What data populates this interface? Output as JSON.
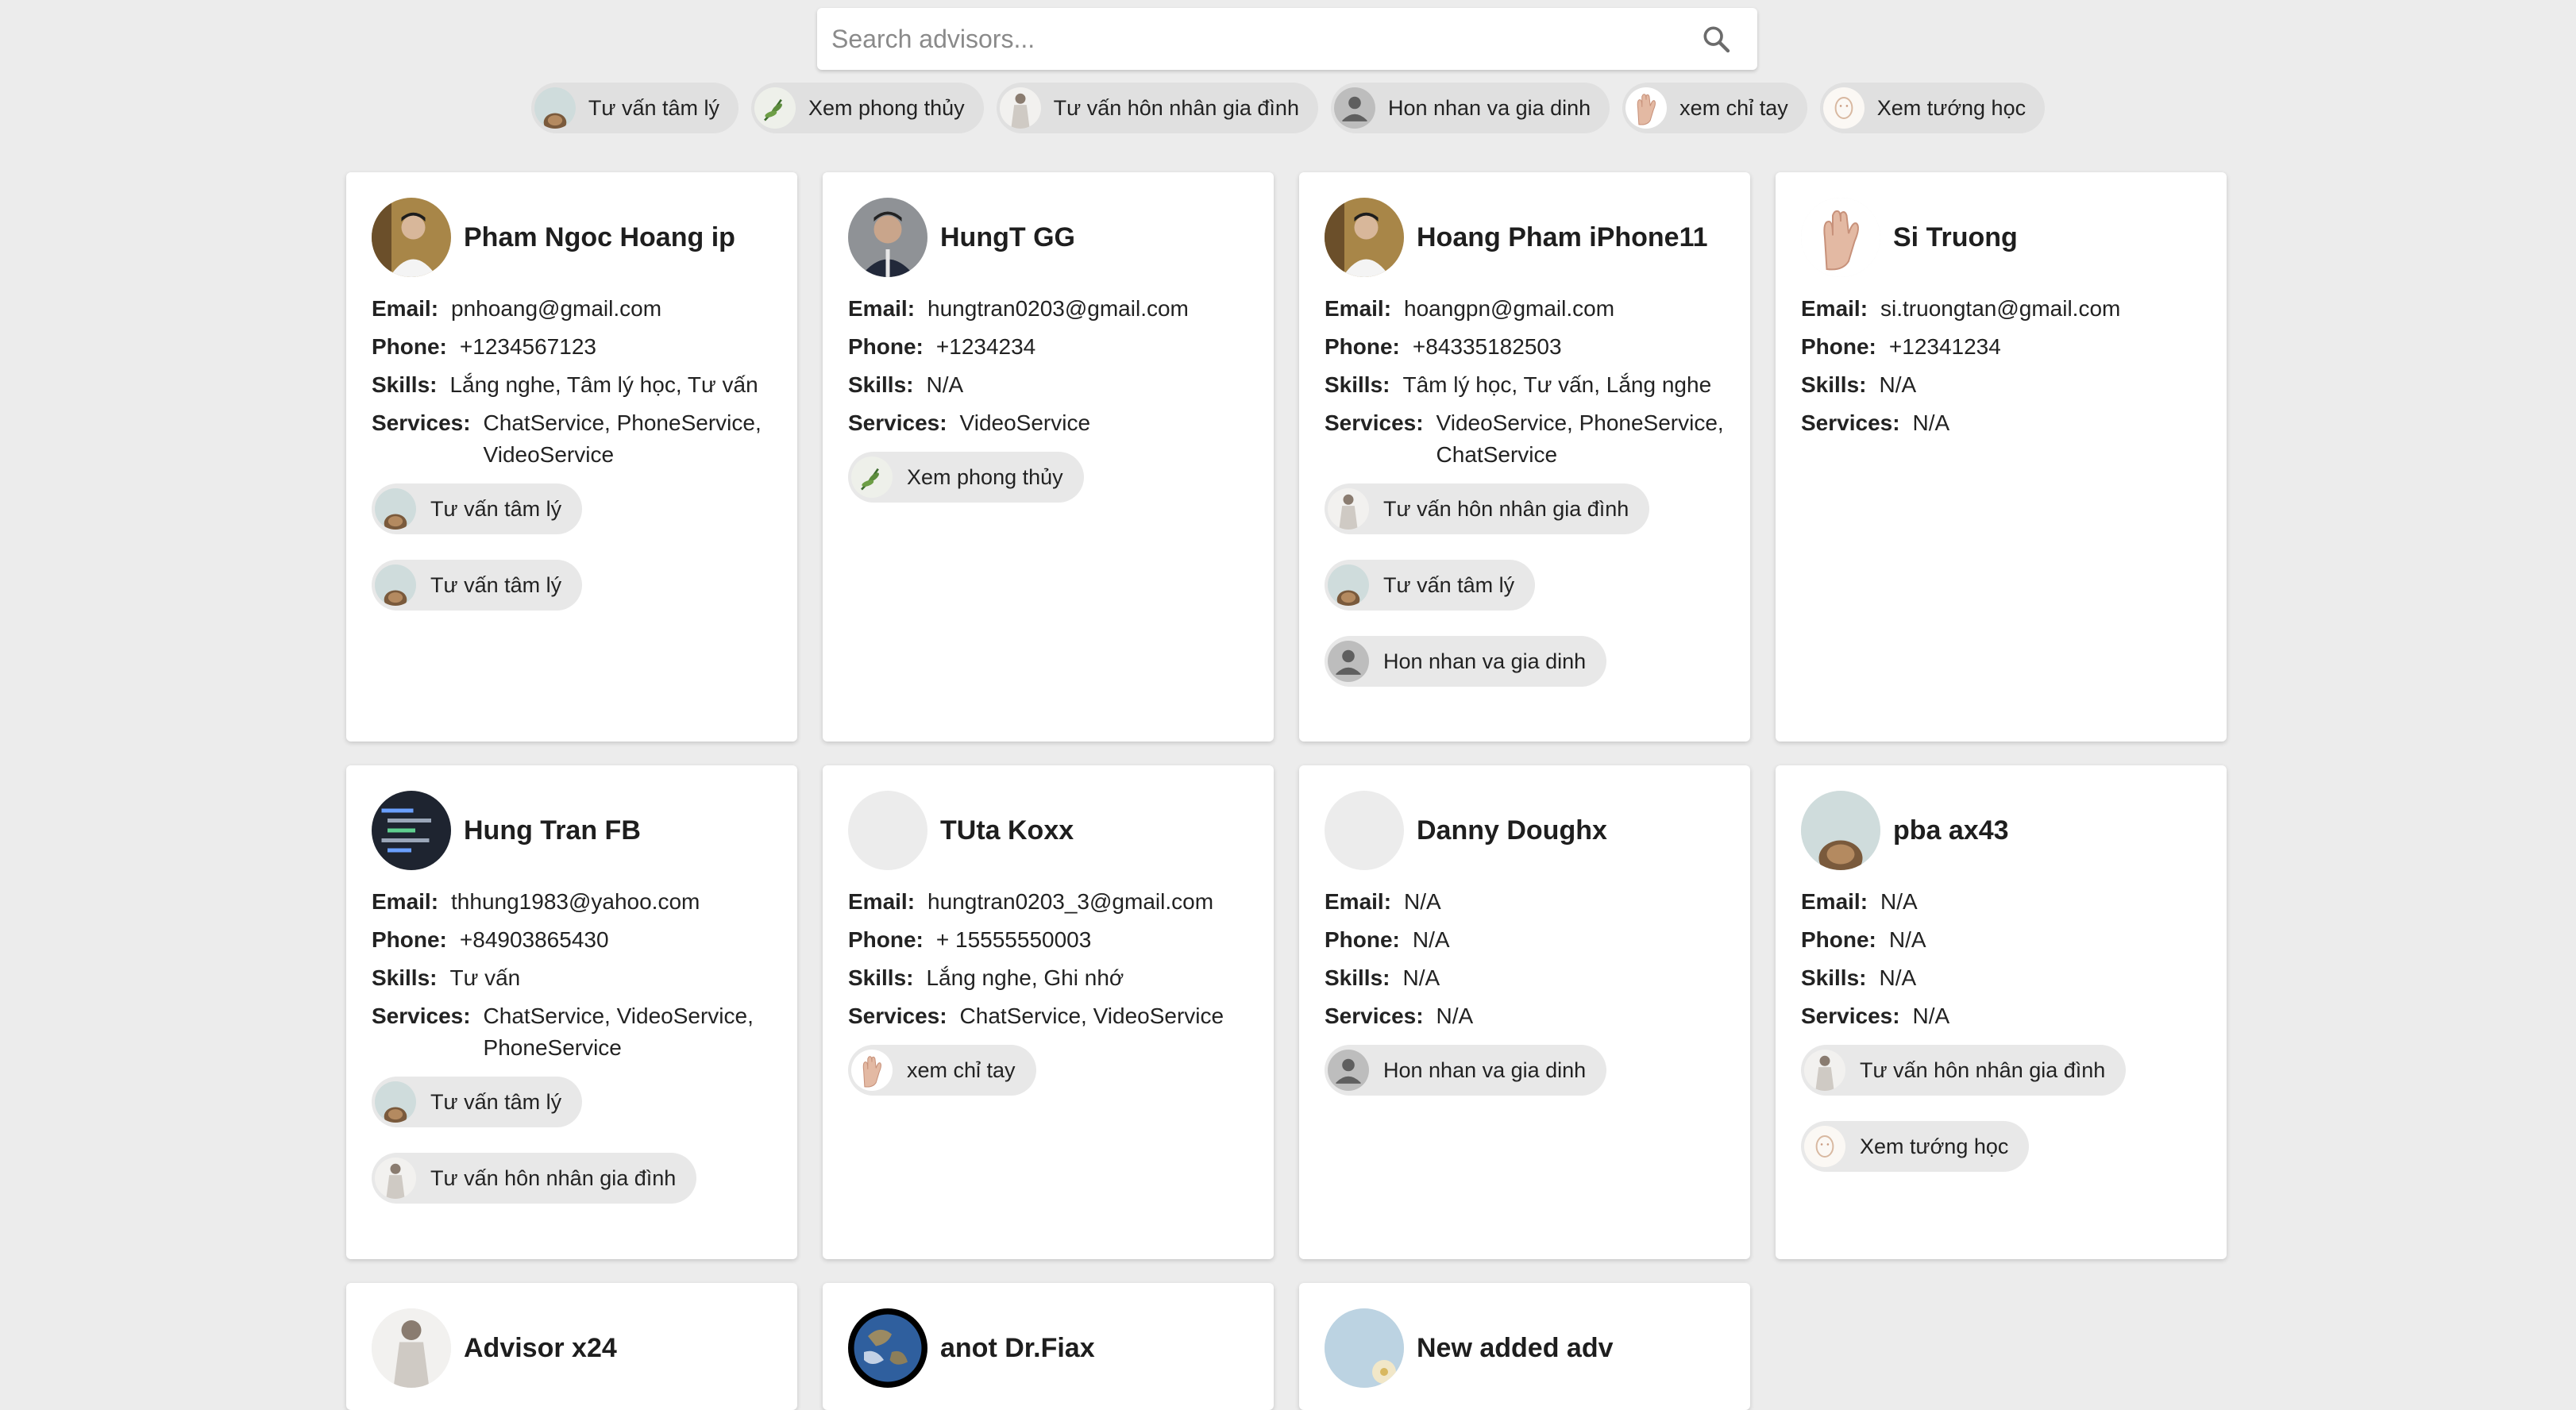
{
  "search": {
    "placeholder": "Search advisors..."
  },
  "filters": [
    {
      "label": "Tư vấn tâm lý",
      "icon": "psychology-photo-icon"
    },
    {
      "label": "Xem phong thủy",
      "icon": "plant-icon"
    },
    {
      "label": "Tư vấn hôn nhân gia đình",
      "icon": "bride-photo-icon"
    },
    {
      "label": "Hon nhan va gia dinh",
      "icon": "person-icon"
    },
    {
      "label": "xem chỉ tay",
      "icon": "palm-icon"
    },
    {
      "label": "Xem tướng học",
      "icon": "face-sketch-icon"
    }
  ],
  "labels": {
    "email": "Email:",
    "phone": "Phone:",
    "skills": "Skills:",
    "services": "Services:"
  },
  "advisors": [
    {
      "name": "Pham Ngoc Hoang ip",
      "avatar": "man-photo-icon",
      "email": "pnhoang@gmail.com",
      "phone": "+1234567123",
      "skills": "Lắng nghe, Tâm lý học, Tư vấn",
      "services": "ChatService, PhoneService, VideoService",
      "tags": [
        "Tư vấn tâm lý",
        "Tư vấn tâm lý"
      ]
    },
    {
      "name": "HungT GG",
      "avatar": "man-portrait-icon",
      "email": "hungtran0203@gmail.com",
      "phone": "+1234234",
      "skills": "N/A",
      "services": "VideoService",
      "tags": [
        "Xem phong thủy"
      ]
    },
    {
      "name": "Hoang Pham iPhone11",
      "avatar": "man-photo-icon",
      "email": "hoangpn@gmail.com",
      "phone": "+84335182503",
      "skills": "Tâm lý học, Tư vấn, Lắng nghe",
      "services": "VideoService, PhoneService, ChatService",
      "tags": [
        "Tư vấn hôn nhân gia đình",
        "Tư vấn tâm lý",
        "Hon nhan va gia dinh"
      ]
    },
    {
      "name": "Si Truong",
      "avatar": "palm-icon",
      "email": "si.truongtan@gmail.com",
      "phone": "+12341234",
      "skills": "N/A",
      "services": "N/A",
      "tags": []
    },
    {
      "name": "Hung Tran FB",
      "avatar": "code-screen-icon",
      "email": "thhung1983@yahoo.com",
      "phone": "+84903865430",
      "skills": "Tư vấn",
      "services": "ChatService, VideoService, PhoneService",
      "tags": [
        "Tư vấn tâm lý",
        "Tư vấn hôn nhân gia đình"
      ]
    },
    {
      "name": "TUta Koxx",
      "avatar": "blank-avatar",
      "email": "hungtran0203_3@gmail.com",
      "phone": "+ 15555550003",
      "skills": "Lắng nghe, Ghi nhớ",
      "services": "ChatService, VideoService",
      "tags": [
        "xem chỉ tay"
      ]
    },
    {
      "name": "Danny Doughx",
      "avatar": "blank-avatar",
      "email": "N/A",
      "phone": "N/A",
      "skills": "N/A",
      "services": "N/A",
      "tags": [
        "Hon nhan va gia dinh"
      ]
    },
    {
      "name": "pba ax43",
      "avatar": "psychology-photo-icon",
      "email": "N/A",
      "phone": "N/A",
      "skills": "N/A",
      "services": "N/A",
      "tags": [
        "Tư vấn hôn nhân gia đình",
        "Xem tướng học"
      ]
    },
    {
      "name": "Advisor x24",
      "avatar": "bride-photo-icon"
    },
    {
      "name": "anot Dr.Fiax",
      "avatar": "earth-icon"
    },
    {
      "name": "New added adv",
      "avatar": "flower-photo-icon"
    }
  ]
}
